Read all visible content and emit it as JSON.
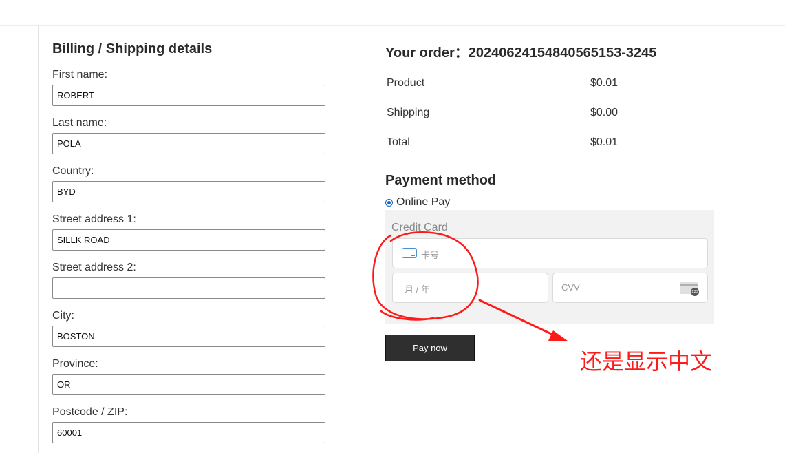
{
  "billing": {
    "title": "Billing / Shipping details",
    "fields": [
      {
        "label": "First name:",
        "value": "ROBERT"
      },
      {
        "label": "Last name:",
        "value": "POLA"
      },
      {
        "label": "Country:",
        "value": "BYD"
      },
      {
        "label": "Street address 1:",
        "value": "SILLK ROAD"
      },
      {
        "label": "Street address 2:",
        "value": ""
      },
      {
        "label": "City:",
        "value": "BOSTON"
      },
      {
        "label": "Province:",
        "value": "OR"
      },
      {
        "label": "Postcode / ZIP:",
        "value": "60001"
      }
    ]
  },
  "order": {
    "title": "Your order：20240624154840565153-3245",
    "rows": [
      {
        "label": "Product",
        "value": "$0.01"
      },
      {
        "label": "Shipping",
        "value": "$0.00"
      },
      {
        "label": "Total",
        "value": "$0.01"
      }
    ]
  },
  "payment": {
    "title": "Payment method",
    "option_label": "Online Pay",
    "credit_card_label": "Credit Card",
    "card_number_placeholder": "卡号",
    "expiry_placeholder": "月 / 年",
    "cvv_placeholder": "CVV",
    "pay_button": "Pay now"
  },
  "annotation": {
    "text": "还是显示中文",
    "color": "#ff1a1a"
  }
}
